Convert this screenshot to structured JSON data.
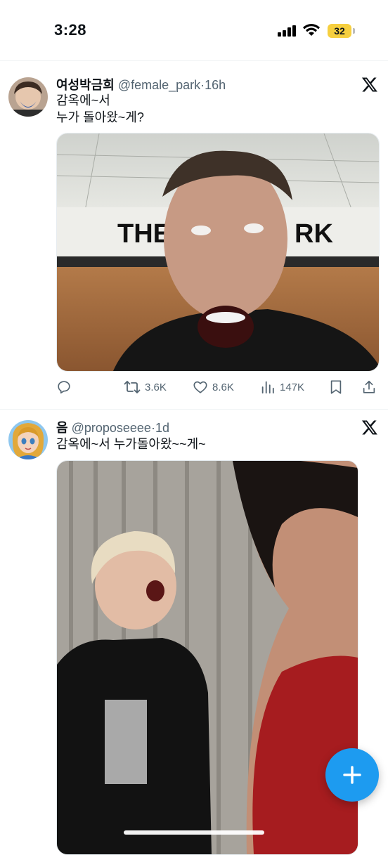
{
  "status_bar": {
    "time": "3:28",
    "battery": "32"
  },
  "tweets": [
    {
      "display_name": "여성박금희",
      "handle": "@female_park",
      "separator": "·",
      "time_ago": "16h",
      "text": "감옥에~서\n누가 돌아왔~게?",
      "media_overlay_left": "THE",
      "media_overlay_right": "RK",
      "actions": {
        "retweets": "3.6K",
        "likes": "8.6K",
        "views": "147K"
      }
    },
    {
      "display_name": "음",
      "handle": "@proposeeee",
      "separator": "·",
      "time_ago": "1d",
      "text": "감옥에~서 누가돌아왔~~게~"
    }
  ],
  "colors": {
    "accent": "#1d9bf0",
    "muted": "#536471",
    "battery": "#f6cf3f"
  },
  "icons": [
    "signal-icon",
    "wifi-icon",
    "x-logo-icon",
    "reply-icon",
    "retweet-icon",
    "like-icon",
    "views-icon",
    "bookmark-icon",
    "share-icon",
    "compose-plus-icon"
  ]
}
